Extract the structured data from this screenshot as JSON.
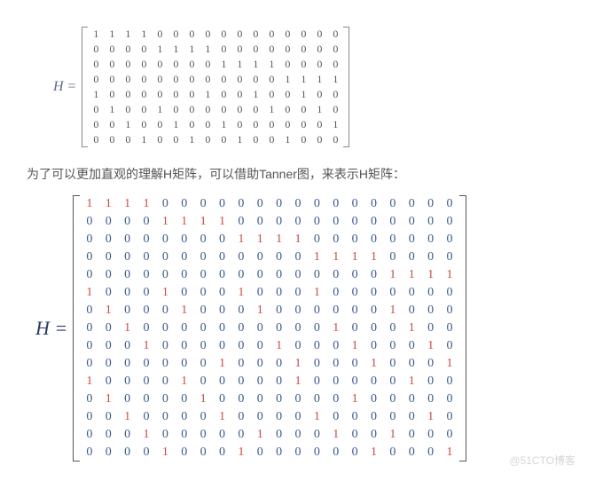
{
  "matrix1_label": "H =",
  "chart_data": [
    {
      "type": "table",
      "name": "H_small",
      "title": "H matrix (8×16)",
      "rows": 8,
      "cols": 16,
      "values": [
        [
          1,
          1,
          1,
          1,
          0,
          0,
          0,
          0,
          0,
          0,
          0,
          0,
          0,
          0,
          0,
          0
        ],
        [
          0,
          0,
          0,
          0,
          1,
          1,
          1,
          1,
          0,
          0,
          0,
          0,
          0,
          0,
          0,
          0
        ],
        [
          0,
          0,
          0,
          0,
          0,
          0,
          0,
          0,
          1,
          1,
          1,
          1,
          0,
          0,
          0,
          0
        ],
        [
          0,
          0,
          0,
          0,
          0,
          0,
          0,
          0,
          0,
          0,
          0,
          0,
          1,
          1,
          1,
          1
        ],
        [
          1,
          0,
          0,
          0,
          0,
          0,
          0,
          1,
          0,
          0,
          1,
          0,
          0,
          1,
          0,
          0
        ],
        [
          0,
          1,
          0,
          0,
          1,
          0,
          0,
          0,
          0,
          0,
          0,
          1,
          0,
          0,
          1,
          0
        ],
        [
          0,
          0,
          1,
          0,
          0,
          1,
          0,
          0,
          1,
          0,
          0,
          0,
          0,
          0,
          0,
          1
        ],
        [
          0,
          0,
          0,
          1,
          0,
          0,
          1,
          0,
          0,
          1,
          0,
          0,
          1,
          0,
          0,
          0
        ]
      ]
    },
    {
      "type": "table",
      "name": "H_large",
      "title": "Tanner-graph H matrix (15×20)",
      "rows": 15,
      "cols": 20,
      "values": [
        [
          1,
          1,
          1,
          1,
          0,
          0,
          0,
          0,
          0,
          0,
          0,
          0,
          0,
          0,
          0,
          0,
          0,
          0,
          0,
          0
        ],
        [
          0,
          0,
          0,
          0,
          1,
          1,
          1,
          1,
          0,
          0,
          0,
          0,
          0,
          0,
          0,
          0,
          0,
          0,
          0,
          0
        ],
        [
          0,
          0,
          0,
          0,
          0,
          0,
          0,
          0,
          1,
          1,
          1,
          1,
          0,
          0,
          0,
          0,
          0,
          0,
          0,
          0
        ],
        [
          0,
          0,
          0,
          0,
          0,
          0,
          0,
          0,
          0,
          0,
          0,
          0,
          1,
          1,
          1,
          1,
          0,
          0,
          0,
          0
        ],
        [
          0,
          0,
          0,
          0,
          0,
          0,
          0,
          0,
          0,
          0,
          0,
          0,
          0,
          0,
          0,
          0,
          1,
          1,
          1,
          1
        ],
        [
          1,
          0,
          0,
          0,
          1,
          0,
          0,
          0,
          1,
          0,
          0,
          0,
          1,
          0,
          0,
          0,
          0,
          0,
          0,
          0
        ],
        [
          0,
          1,
          0,
          0,
          0,
          1,
          0,
          0,
          0,
          1,
          0,
          0,
          0,
          0,
          0,
          0,
          1,
          0,
          0,
          0
        ],
        [
          0,
          0,
          1,
          0,
          0,
          0,
          0,
          0,
          0,
          0,
          0,
          0,
          0,
          1,
          0,
          0,
          0,
          1,
          0,
          0
        ],
        [
          0,
          0,
          0,
          1,
          0,
          0,
          0,
          0,
          0,
          0,
          1,
          0,
          0,
          0,
          1,
          0,
          0,
          0,
          1,
          0
        ],
        [
          0,
          0,
          0,
          0,
          0,
          0,
          0,
          1,
          0,
          0,
          0,
          1,
          0,
          0,
          0,
          1,
          0,
          0,
          0,
          1
        ],
        [
          1,
          0,
          0,
          0,
          0,
          1,
          0,
          0,
          0,
          0,
          0,
          1,
          0,
          0,
          0,
          0,
          0,
          1,
          0,
          0
        ],
        [
          0,
          1,
          0,
          0,
          0,
          0,
          1,
          0,
          0,
          0,
          0,
          0,
          0,
          0,
          1,
          0,
          0,
          0,
          0,
          0
        ],
        [
          0,
          0,
          1,
          0,
          0,
          0,
          0,
          1,
          0,
          0,
          0,
          0,
          1,
          0,
          0,
          0,
          0,
          0,
          1,
          0
        ],
        [
          0,
          0,
          0,
          1,
          0,
          0,
          0,
          0,
          0,
          1,
          0,
          0,
          0,
          1,
          0,
          0,
          1,
          0,
          0,
          0
        ],
        [
          0,
          0,
          0,
          0,
          1,
          0,
          0,
          0,
          1,
          0,
          0,
          0,
          0,
          0,
          0,
          1,
          0,
          0,
          0,
          1
        ]
      ]
    }
  ],
  "description": "为了可以更加直观的理解H矩阵，可以借助Tanner图，来表示H矩阵：",
  "matrix2_label": "H =",
  "watermark": "@51CTO博客"
}
